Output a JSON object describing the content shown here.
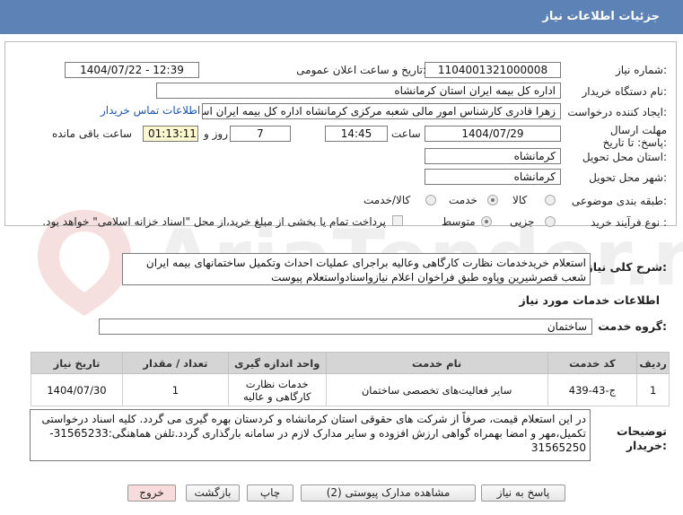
{
  "header": {
    "title": "جزئیات اطلاعات نیاز"
  },
  "fields": {
    "need_number_label": "شماره نیاز:",
    "need_number": "1104001321000008",
    "announce_label": "تاریخ و ساعت اعلان عمومی:",
    "announce_value": "1404/07/22 - 12:39",
    "buyer_org_label": "نام دستگاه خریدار:",
    "buyer_org": "اداره کل بیمه ایران استان کرمانشاه",
    "creator_label": "ایجاد کننده درخواست:",
    "creator": "زهرا قادری کارشناس امور مالی شعبه مرکزی کرمانشاه اداره کل بیمه ایران استا",
    "contact_link": "اطلاعات تماس خریدار",
    "deadline_label": "مهلت ارسال پاسخ: تا تاریخ:",
    "deadline_date": "1404/07/29",
    "time_label": "ساعت",
    "deadline_time": "14:45",
    "days_value": "7",
    "days_label": "روز و",
    "remaining_time": "01:13:11",
    "remaining_label": "ساعت باقی مانده",
    "province_label": "استان محل تحویل:",
    "province": "کرمانشاه",
    "city_label": "شهر محل تحویل:",
    "city": "کرمانشاه",
    "category_label": "طبقه بندی موضوعی:",
    "category_options": [
      "کالا",
      "خدمت",
      "کالا/خدمت"
    ],
    "category_selected": "خدمت",
    "process_label": "نوع فرآیند خرید :",
    "process_options": [
      "جزیی",
      "متوسط"
    ],
    "process_selected": "متوسط",
    "payment_note": "پرداخت تمام یا بخشی از مبلغ خرید،از محل \"اسناد خزانه اسلامی\" خواهد بود."
  },
  "need_desc": {
    "label": "شرح کلی نیاز:",
    "text": "استعلام خریدخدمات نظارت کارگاهی وعالیه براجرای عملیات احداث وتکمیل ساختمانهای بیمه ایران شعب قصرشیرین وپاوه طبق فراخوان اعلام نیازواسنادواستعلام پیوست"
  },
  "services": {
    "section_title": "اطلاعات خدمات مورد نیاز",
    "group_label": "گروه خدمت:",
    "group_value": "ساختمان",
    "columns": [
      "ردیف",
      "کد خدمت",
      "نام خدمت",
      "واحد اندازه گیری",
      "تعداد / مقدار",
      "تاریخ نیاز"
    ],
    "rows": [
      {
        "row": "1",
        "code": "ج-43-439",
        "name": "سایر فعالیت‌های تخصصی ساختمان",
        "unit": "خدمات نظارت کارگاهی و عالیه",
        "qty": "1",
        "date": "1404/07/30"
      }
    ]
  },
  "buyer_desc": {
    "label": "توضیحات خریدار:",
    "text": "در این استعلام قیمت، صرفاً از شرکت های حقوقی استان کرمانشاه و کردستان  بهره گیری می گردد. کلیه اسناد درخواستی تکمیل،مهر و امضا بهمراه گواهی ارزش افزوده و سایر مدارک لازم در سامانه بارگذاری گردد.تلفن هماهنگی:31565233-31565250"
  },
  "buttons": {
    "reply": "پاسخ به نیاز",
    "view_docs": "مشاهده مدارک پیوستی (2)",
    "print": "چاپ",
    "back": "بازگشت",
    "exit": "خروج"
  },
  "watermark": {
    "text": "AriaTender.neT"
  },
  "colors": {
    "header": "#5d82b6",
    "link": "#1a56b4",
    "remaining_bg": "#fbf7cf",
    "exit_bg": "#f8dcdc"
  }
}
